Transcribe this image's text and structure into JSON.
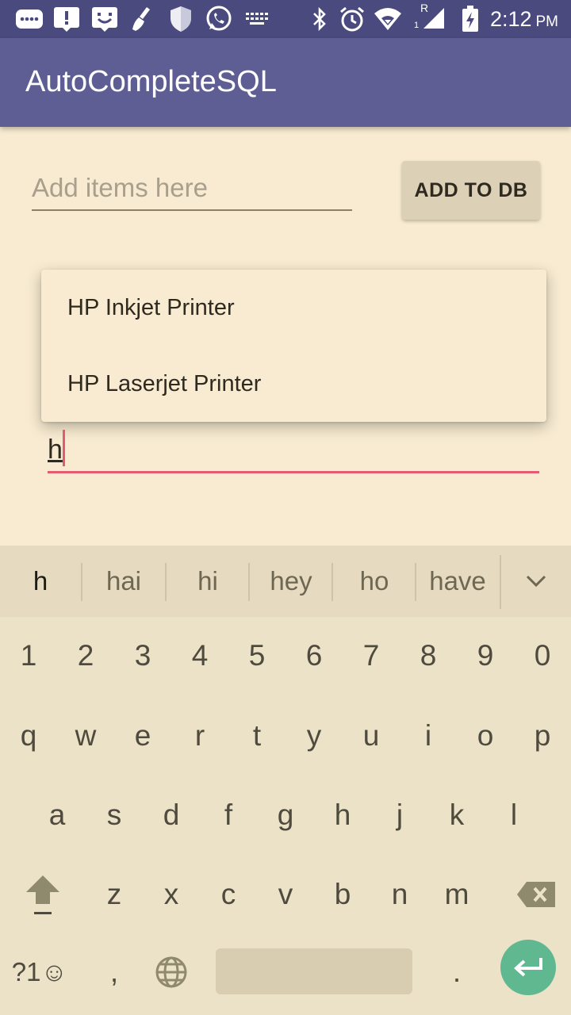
{
  "status_bar": {
    "time": "2:12",
    "ampm": "PM",
    "icons": [
      "keyboard-notification-icon",
      "alert-icon",
      "bot-icon",
      "broom-icon",
      "shield-icon",
      "whatsapp-icon",
      "keyboard-icon",
      "bluetooth-icon",
      "alarm-icon",
      "wifi-icon",
      "signal-icon",
      "battery-charging-icon"
    ],
    "roaming": "R",
    "sim": "1"
  },
  "app_bar": {
    "title": "AutoCompleteSQL"
  },
  "form": {
    "add_placeholder": "Add items here",
    "add_button": "ADD TO DB"
  },
  "autocomplete": {
    "items": [
      "HP Inkjet Printer",
      "HP Laserjet Printer"
    ],
    "value": "h"
  },
  "keyboard": {
    "suggestions": [
      "h",
      "hai",
      "hi",
      "hey",
      "ho",
      "have"
    ],
    "row_numbers": [
      "1",
      "2",
      "3",
      "4",
      "5",
      "6",
      "7",
      "8",
      "9",
      "0"
    ],
    "row_1": [
      "q",
      "w",
      "e",
      "r",
      "t",
      "y",
      "u",
      "i",
      "o",
      "p"
    ],
    "row_2": [
      "a",
      "s",
      "d",
      "f",
      "g",
      "h",
      "j",
      "k",
      "l"
    ],
    "row_3": [
      "z",
      "x",
      "c",
      "v",
      "b",
      "n",
      "m"
    ],
    "symbols_key": "?1☺",
    "comma_key": ",",
    "period_key": "."
  },
  "colors": {
    "status_bar": "#4a4a7e",
    "app_bar": "#5e5e95",
    "background": "#f8ebd1",
    "accent": "#e35b72",
    "enter_key": "#5fb88f",
    "keyboard": "#ece2c8"
  }
}
